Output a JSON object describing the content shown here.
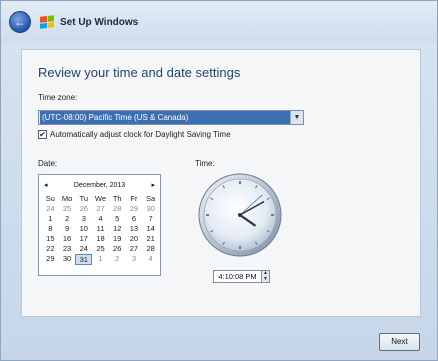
{
  "window": {
    "title": "Set Up Windows"
  },
  "page": {
    "heading": "Review your time and date settings"
  },
  "timezone": {
    "label": "Time zone:",
    "selected": "(UTC-08:00) Pacific Time (US & Canada)",
    "dst_label": "Automatically adjust clock for Daylight Saving Time",
    "dst_checked": true
  },
  "date": {
    "label": "Date:",
    "month": "December, 2013",
    "prev": "◂",
    "next": "▸",
    "weekdays": [
      "Su",
      "Mo",
      "Tu",
      "We",
      "Th",
      "Fr",
      "Sa"
    ],
    "days": [
      [
        "24",
        "25",
        "26",
        "27",
        "28",
        "29",
        "30"
      ],
      [
        "1",
        "2",
        "3",
        "4",
        "5",
        "6",
        "7"
      ],
      [
        "8",
        "9",
        "10",
        "11",
        "12",
        "13",
        "14"
      ],
      [
        "15",
        "16",
        "17",
        "18",
        "19",
        "20",
        "21"
      ],
      [
        "22",
        "23",
        "24",
        "25",
        "26",
        "27",
        "28"
      ],
      [
        "29",
        "30",
        "31",
        "1",
        "2",
        "3",
        "4"
      ]
    ],
    "selected_day": "31"
  },
  "time": {
    "label": "Time:",
    "value": "4:10:08 PM",
    "hours": 16,
    "minutes": 10,
    "seconds": 8
  },
  "buttons": {
    "next": "Next"
  },
  "colors": {
    "accent": "#3d6fb4",
    "heading": "#21466f",
    "selection": "#cfe0f4"
  },
  "icons": [
    "back-arrow-icon",
    "windows-logo-icon",
    "dropdown-arrow-icon",
    "checkmark-icon",
    "spin-up-icon",
    "spin-down-icon"
  ]
}
